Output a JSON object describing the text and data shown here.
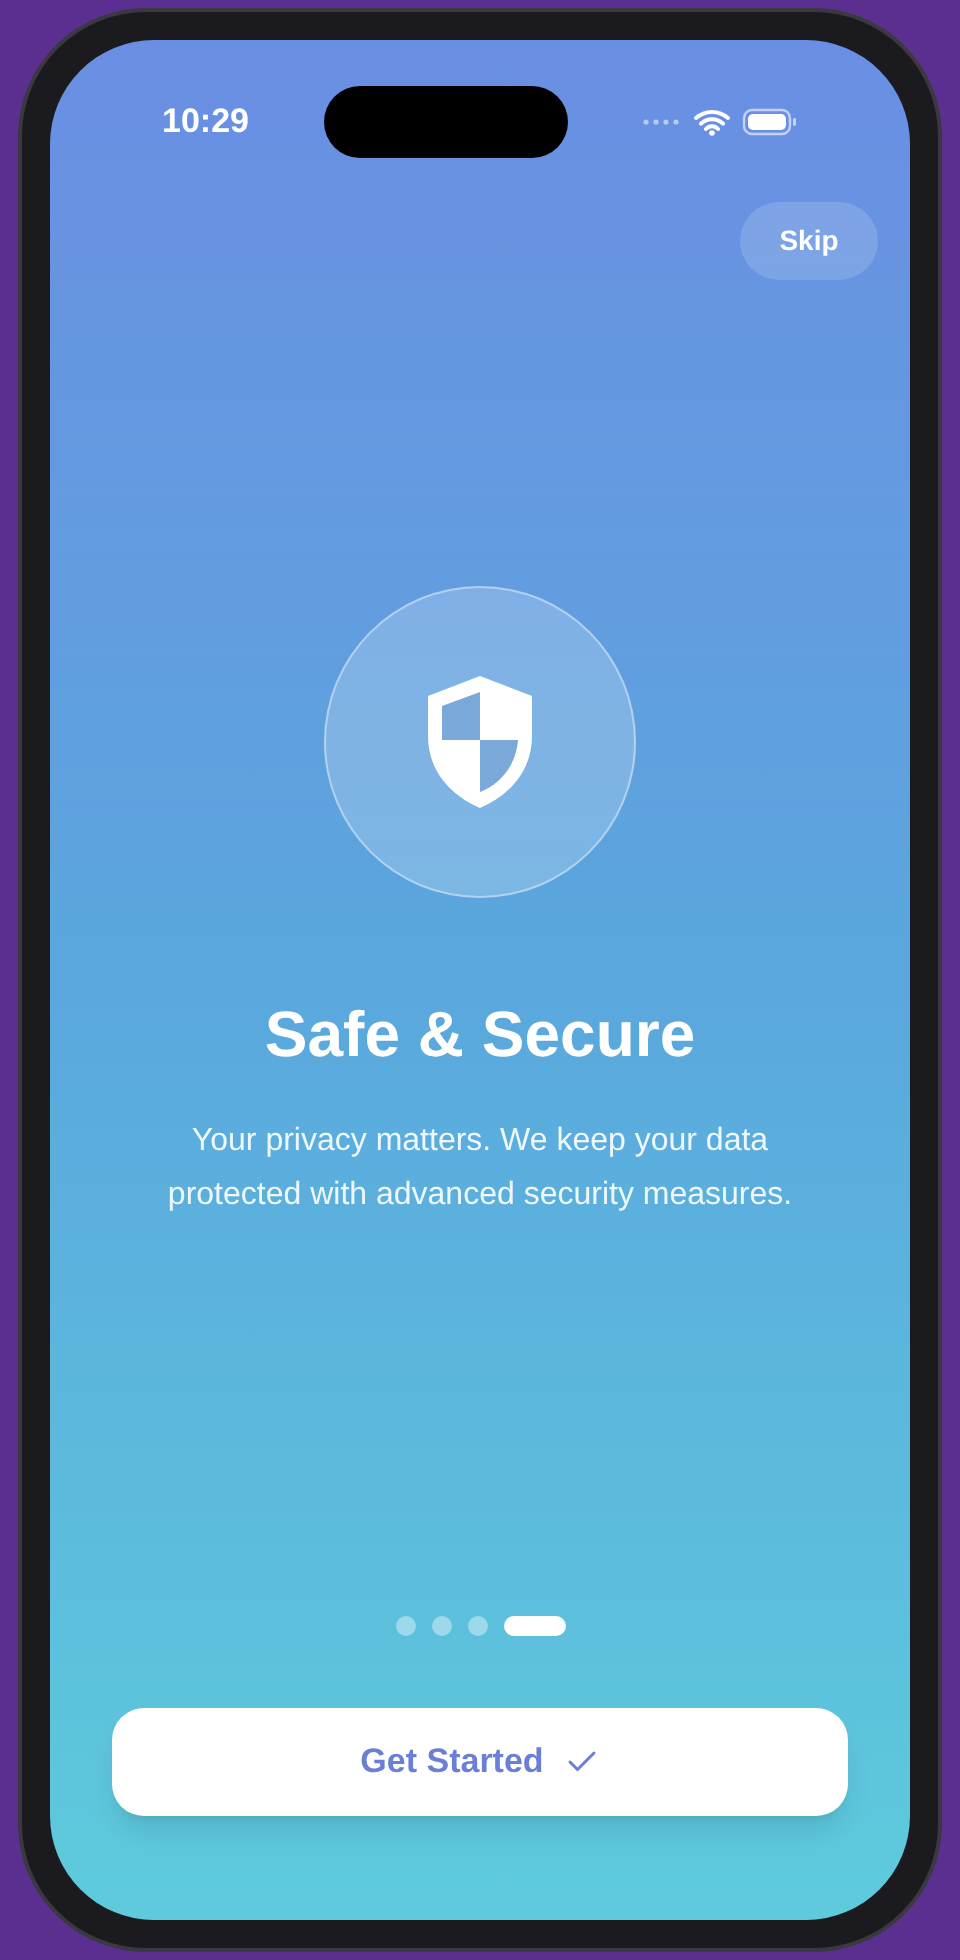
{
  "status_bar": {
    "time": "10:29"
  },
  "skip_button": {
    "label": "Skip"
  },
  "title": "Safe & Secure",
  "description": "Your privacy matters. We keep your data protected with advanced security measures.",
  "pagination": [
    {
      "selected": false
    },
    {
      "selected": false
    },
    {
      "selected": false
    },
    {
      "selected": true
    }
  ],
  "primary_button": {
    "label": "Get Started"
  }
}
